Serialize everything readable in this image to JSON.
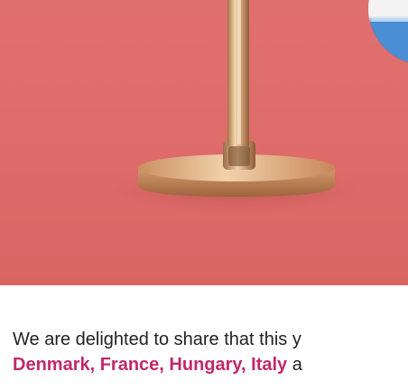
{
  "article": {
    "intro_text": "We are delighted to share that this y",
    "countries_text": "Denmark, France, Hungary, Italy",
    "after_countries_text": " a"
  },
  "colors": {
    "hero_background": "#e0706e",
    "accent_text": "#c2286a",
    "body_text": "#222222",
    "flag_white": "#f4f4f4",
    "flag_blue": "#4a8fd6"
  },
  "hero": {
    "icon_trophy": "trophy-lamp-icon",
    "icon_flag": "flag-badge-icon"
  }
}
